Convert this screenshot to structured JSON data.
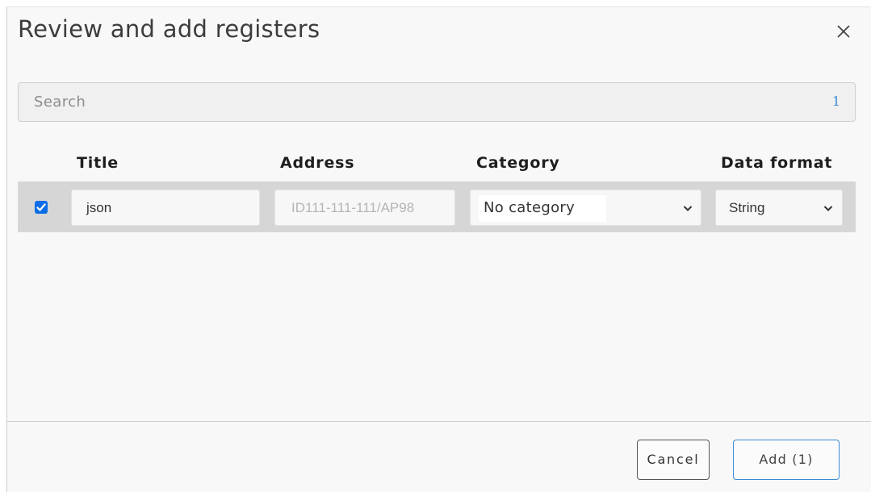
{
  "dialog": {
    "title": "Review and add registers",
    "close_icon": "close-icon"
  },
  "search": {
    "placeholder": "Search",
    "count": "1"
  },
  "columns": [
    "Title",
    "Address",
    "Category",
    "Data format"
  ],
  "rows": [
    {
      "checked": true,
      "title": "json",
      "address": "ID111-111-111/AP98",
      "category": "No category",
      "data_format": "String"
    }
  ],
  "footer": {
    "cancel_label": "Cancel",
    "add_label": "Add (1)"
  },
  "colors": {
    "accent": "#0b6ee8",
    "count_text": "#3d8ad6",
    "row_background": "#d6d6d6"
  }
}
